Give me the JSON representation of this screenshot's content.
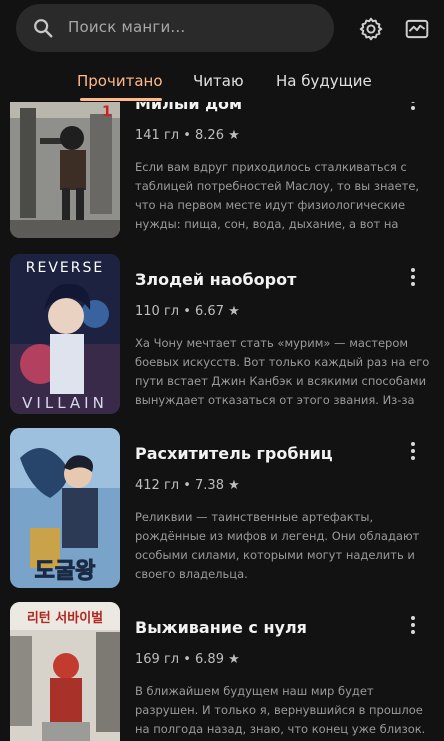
{
  "search": {
    "placeholder": "Поиск манги..."
  },
  "top_icons": [
    "search-icon",
    "settings-gear-icon",
    "trending-chart-icon"
  ],
  "tabs": [
    {
      "label": "Прочитано",
      "active": true
    },
    {
      "label": "Читаю",
      "active": false
    },
    {
      "label": "На будущие",
      "active": false
    }
  ],
  "accent_color": "#ffb98a",
  "items": [
    {
      "title": "Милый дом",
      "meta": "141 гл • 8.26 ★",
      "description": "Если вам вдруг приходилось сталкиваться с таблицей потребностей Маслоу, то вы знаете, что на первом месте идут физиологические нужды: пища, сон, вода, дыхание, а вот на втором месте..."
    },
    {
      "title": "Злодей наоборот",
      "meta": "110 гл • 6.67 ★",
      "cover_text_top": "REVERSE",
      "cover_text_bottom": "VILLAIN",
      "description": "Ха Чону мечтает стать «мурим» — мастером боевых искусств. Вот только каждый раз на его пути встает Джин Канбэк и всякими способами вынуждает отказаться от этого звания. Из-за Кан..."
    },
    {
      "title": "Расхититель гробниц",
      "meta": "412 гл • 7.38 ★",
      "cover_text_bottom": "도굴왕",
      "description": "Реликвии — таинственные артефакты, рождённые из мифов и легенд. Они обладают особыми силами, которыми могут наделить и своего владельца."
    },
    {
      "title": "Выживание с нуля",
      "meta": "169 гл • 6.89 ★",
      "cover_text_top": "리턴 서바이벌",
      "description": "В ближайшем будущем наш мир будет разрушен. И только я, вернувшийся в прошлое на полгода назад, знаю, что конец уже близок. Удастся ли противостоять разрушению мира и и..."
    }
  ]
}
